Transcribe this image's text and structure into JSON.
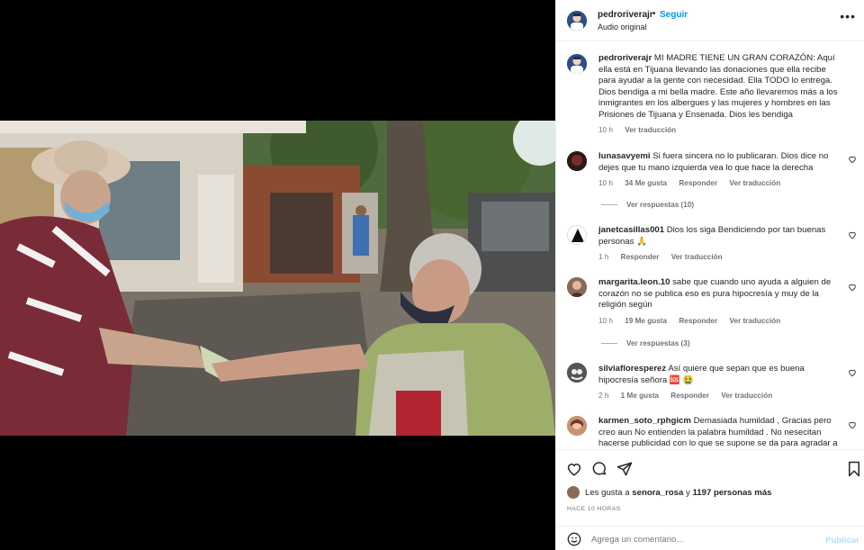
{
  "post": {
    "username": "pedroriverajr",
    "separator": "•",
    "follow_label": "Seguir",
    "audio": "Audio original",
    "more_icon": "more-horizontal-icon",
    "caption": "MI MADRE TIENE UN GRAN CORAZÓN: Aquí ella está en Tijuana llevando las donaciones que ella recibe para ayudar a la gente con necesidad. Ella TODO lo entrega. Dios bendiga a mi bella madre. Este año llevaremos más a los inmigrantes en los albergues y las mujeres y hombres en las Prisiones de Tijuana y Ensenada. Dios les bendiga",
    "caption_time": "10 h",
    "caption_translate": "Ver traducción"
  },
  "comments": [
    {
      "user": "lunasavyemi",
      "text": "Si fuera sincera no lo publicaran. Dios dice no dejes que tu mano izquierda vea lo que hace la derecha",
      "time": "10 h",
      "likes": "34 Me gusta",
      "reply": "Responder",
      "translate": "Ver traducción",
      "replies_label": "Ver respuestas (10)"
    },
    {
      "user": "janetcasillas001",
      "text": "Dios los siga Bendiciendo por tan buenas personas 🙏",
      "time": "1 h",
      "likes": "",
      "reply": "Responder",
      "translate": "Ver traducción",
      "replies_label": ""
    },
    {
      "user": "margarita.leon.10",
      "text": "sabe que cuando uno ayuda a alguien de corazón no se publica eso es pura hipocresía y muy de la religión según",
      "time": "10 h",
      "likes": "19 Me gusta",
      "reply": "Responder",
      "translate": "Ver traducción",
      "replies_label": "Ver respuestas (3)"
    },
    {
      "user": "silviafloresperez",
      "text": "Así quiere que sepan que es buena hipocresía señora 🆘 🤮",
      "time": "2 h",
      "likes": "1 Me gusta",
      "reply": "Responder",
      "translate": "Ver traducción",
      "replies_label": ""
    },
    {
      "user": "karmen_soto_rphgicm",
      "text": "Demasiada humildad , Gracias pero creo aun No entienden la palabra humildad . No nesecitan hacerse publicidad con lo que se supone se da para agradar a",
      "time": "",
      "likes": "",
      "reply": "",
      "translate": "",
      "replies_label": ""
    }
  ],
  "actions": {
    "like_icon": "heart-icon",
    "comment_icon": "comment-icon",
    "share_icon": "send-icon",
    "save_icon": "bookmark-icon"
  },
  "likes_line": {
    "prefix": "Les gusta a",
    "user": "senora_rosa",
    "middle": "y",
    "count": "1197 personas más"
  },
  "posted_ago": "HACE 10 HORAS",
  "add_comment": {
    "emoji_icon": "emoji-icon",
    "placeholder": "Agrega un comentario...",
    "publish_label": "Publicar"
  },
  "video": {
    "mute_icon": "speaker-muted-icon"
  }
}
